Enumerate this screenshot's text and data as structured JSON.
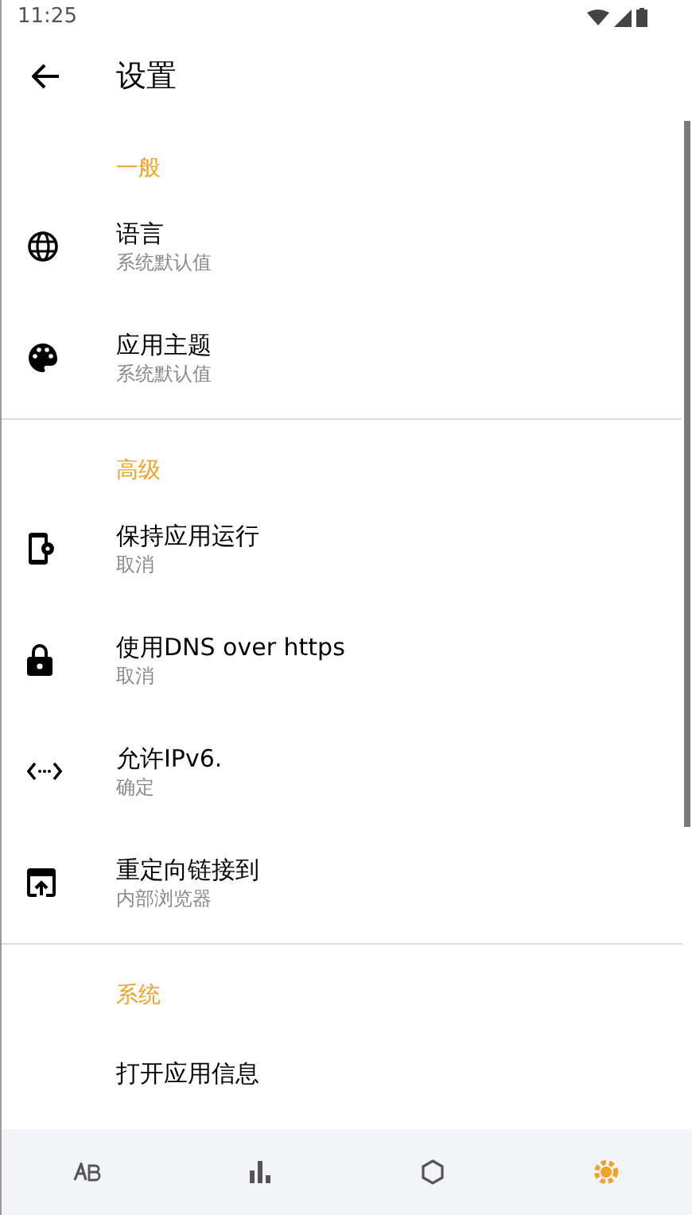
{
  "status_bar": {
    "time": "11:25"
  },
  "toolbar": {
    "title": "设置"
  },
  "sections": [
    {
      "header": "一般",
      "items": [
        {
          "title": "语言",
          "summary": "系统默认值"
        },
        {
          "title": "应用主题",
          "summary": "系统默认值"
        }
      ]
    },
    {
      "header": "高级",
      "items": [
        {
          "title": "保持应用运行",
          "summary": "取消"
        },
        {
          "title": "使用DNS over https",
          "summary": "取消"
        },
        {
          "title": "允许IPv6.",
          "summary": "确定"
        },
        {
          "title": "重定向链接到",
          "summary": "内部浏览器"
        }
      ]
    },
    {
      "header": "系统",
      "items": [
        {
          "title": "打开应用信息"
        }
      ]
    }
  ],
  "bottom_nav": [
    {
      "selected": false
    },
    {
      "selected": false
    },
    {
      "selected": false
    },
    {
      "selected": true
    }
  ]
}
